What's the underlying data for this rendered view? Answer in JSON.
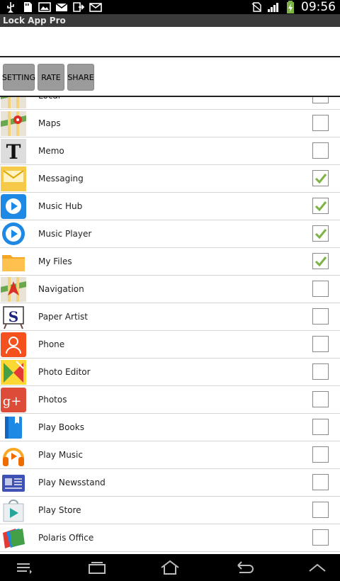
{
  "status_bar": {
    "time": "09:56",
    "icons": [
      "usb-icon",
      "sd-card-icon",
      "image-icon",
      "gmail-icon",
      "download-icon",
      "email-icon",
      "no-sim-icon",
      "signal-icon",
      "battery-charging-icon"
    ]
  },
  "app": {
    "title": "Lock App Pro"
  },
  "toolbar": {
    "setting_label": "SETTING",
    "rate_label": "RATE",
    "share_label": "SHARE"
  },
  "apps": [
    {
      "name": "Local",
      "icon": "maps-icon",
      "checked": false
    },
    {
      "name": "Maps",
      "icon": "maps-icon",
      "checked": false
    },
    {
      "name": "Memo",
      "icon": "memo-icon",
      "checked": false
    },
    {
      "name": "Messaging",
      "icon": "messaging-icon",
      "checked": true
    },
    {
      "name": "Music Hub",
      "icon": "music-hub-icon",
      "checked": true
    },
    {
      "name": "Music Player",
      "icon": "music-player-icon",
      "checked": true
    },
    {
      "name": "My Files",
      "icon": "folder-icon",
      "checked": true
    },
    {
      "name": "Navigation",
      "icon": "navigation-icon",
      "checked": false
    },
    {
      "name": "Paper Artist",
      "icon": "paper-artist-icon",
      "checked": false
    },
    {
      "name": "Phone",
      "icon": "phone-icon",
      "checked": false
    },
    {
      "name": "Photo Editor",
      "icon": "photo-editor-icon",
      "checked": false
    },
    {
      "name": "Photos",
      "icon": "google-plus-icon",
      "checked": false
    },
    {
      "name": "Play Books",
      "icon": "play-books-icon",
      "checked": false
    },
    {
      "name": "Play Music",
      "icon": "headphones-icon",
      "checked": false
    },
    {
      "name": "Play Newsstand",
      "icon": "newsstand-icon",
      "checked": false
    },
    {
      "name": "Play Store",
      "icon": "play-store-icon",
      "checked": false
    },
    {
      "name": "Polaris Office",
      "icon": "polaris-office-icon",
      "checked": false
    }
  ],
  "nav_bar": {
    "icons": [
      "menu-icon",
      "recent-apps-icon",
      "home-icon",
      "back-icon",
      "up-chevron-icon"
    ]
  },
  "colors": {
    "check_green": "#7cb342",
    "title_bar": "#3a3a3a",
    "button_gray": "#9b9b9b"
  }
}
